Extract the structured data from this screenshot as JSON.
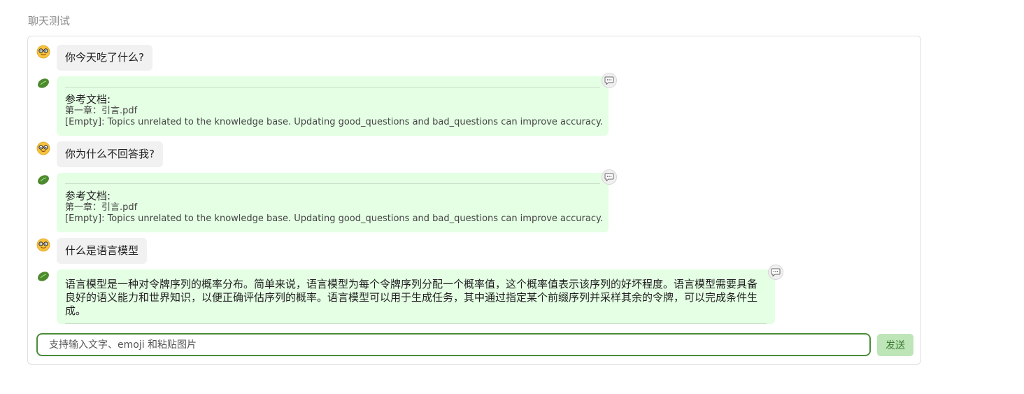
{
  "page": {
    "title": "聊天测试"
  },
  "messages": [
    {
      "role": "user",
      "text": "你今天吃了什么?"
    },
    {
      "role": "bot",
      "ref_heading": "参考文档:",
      "ref_file": "第一章：引言.pdf",
      "ref_note": "[Empty]: Topics unrelated to the knowledge base. Updating good_questions and bad_questions can improve accuracy."
    },
    {
      "role": "user",
      "text": "你为什么不回答我?"
    },
    {
      "role": "bot",
      "ref_heading": "参考文档:",
      "ref_file": "第一章：引言.pdf",
      "ref_note": "[Empty]: Topics unrelated to the knowledge base. Updating good_questions and bad_questions can improve accuracy."
    },
    {
      "role": "user",
      "text": "什么是语言模型"
    },
    {
      "role": "bot",
      "text": "语言模型是一种对令牌序列的概率分布。简单来说，语言模型为每个令牌序列分配一个概率值，这个概率值表示该序列的好坏程度。语言模型需要具备良好的语义能力和世界知识，以便正确评估序列的概率。语言模型可以用于生成任务，其中通过指定某个前缀序列并采样其余的令牌，可以完成条件生成。"
    }
  ],
  "input": {
    "placeholder": "支持输入文字、emoji 和粘贴图片",
    "value": ""
  },
  "send_button": {
    "label": "发送"
  },
  "colors": {
    "user_bubble": "#f1f1f1",
    "bot_bubble": "#e4ffe4",
    "accent": "#4a8c3a",
    "send_bg": "#bde5b8"
  },
  "icons": {
    "user_avatar": "nerd-face-icon",
    "bot_avatar": "bean-icon",
    "comment": "speech-bubble-icon"
  }
}
